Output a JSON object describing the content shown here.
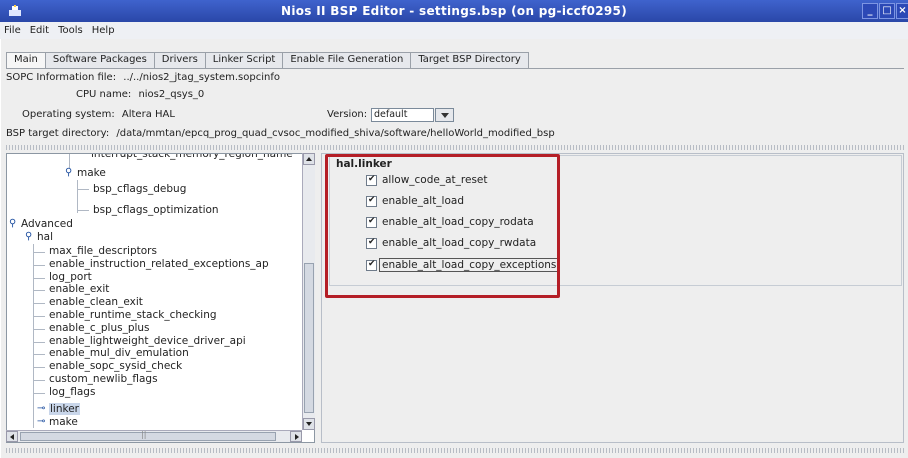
{
  "window": {
    "title": "Nios II BSP Editor - settings.bsp (on pg-iccf0295)",
    "controls": [
      "minimize",
      "maximize",
      "close"
    ]
  },
  "menu": [
    "File",
    "Edit",
    "Tools",
    "Help"
  ],
  "tabs": [
    {
      "label": "Main",
      "active": true
    },
    {
      "label": "Software Packages",
      "active": false
    },
    {
      "label": "Drivers",
      "active": false
    },
    {
      "label": "Linker Script",
      "active": false
    },
    {
      "label": "Enable File Generation",
      "active": false
    },
    {
      "label": "Target BSP Directory",
      "active": false
    }
  ],
  "info": {
    "sopc_label": "SOPC Information file:",
    "sopc_value": "../../nios2_jtag_system.sopcinfo",
    "cpu_label": "CPU name:",
    "cpu_value": "nios2_qsys_0",
    "os_label": "Operating system:",
    "os_value": "Altera HAL",
    "version_label": "Version:",
    "version_value": "default",
    "bsp_label": "BSP target directory:",
    "bsp_value": "/data/mmtan/epcq_prog_quad_cvsoc_modified_shiva/software/helloWorld_modified_bsp"
  },
  "tree": {
    "partial_top": "interrupt_stack_memory_region_name",
    "make_top": "make",
    "make_children": [
      "bsp_cflags_debug",
      "bsp_cflags_optimization"
    ],
    "advanced": "Advanced",
    "hal": "hal",
    "hal_children": [
      "max_file_descriptors",
      "enable_instruction_related_exceptions_ap",
      "log_port",
      "enable_exit",
      "enable_clean_exit",
      "enable_runtime_stack_checking",
      "enable_c_plus_plus",
      "enable_lightweight_device_driver_api",
      "enable_mul_div_emulation",
      "enable_sopc_sysid_check",
      "custom_newlib_flags",
      "log_flags"
    ],
    "linker": "linker",
    "make_bottom": "make"
  },
  "settings": {
    "group_title": "hal.linker",
    "options": [
      {
        "label": "allow_code_at_reset",
        "checked": true
      },
      {
        "label": "enable_alt_load",
        "checked": true
      },
      {
        "label": "enable_alt_load_copy_rodata",
        "checked": true
      },
      {
        "label": "enable_alt_load_copy_rwdata",
        "checked": true
      },
      {
        "label": "enable_alt_load_copy_exceptions",
        "checked": true
      }
    ]
  },
  "colors": {
    "titlebar": "#3f63cd",
    "highlight": "#b41e26",
    "selection": "#c9d6ea"
  }
}
